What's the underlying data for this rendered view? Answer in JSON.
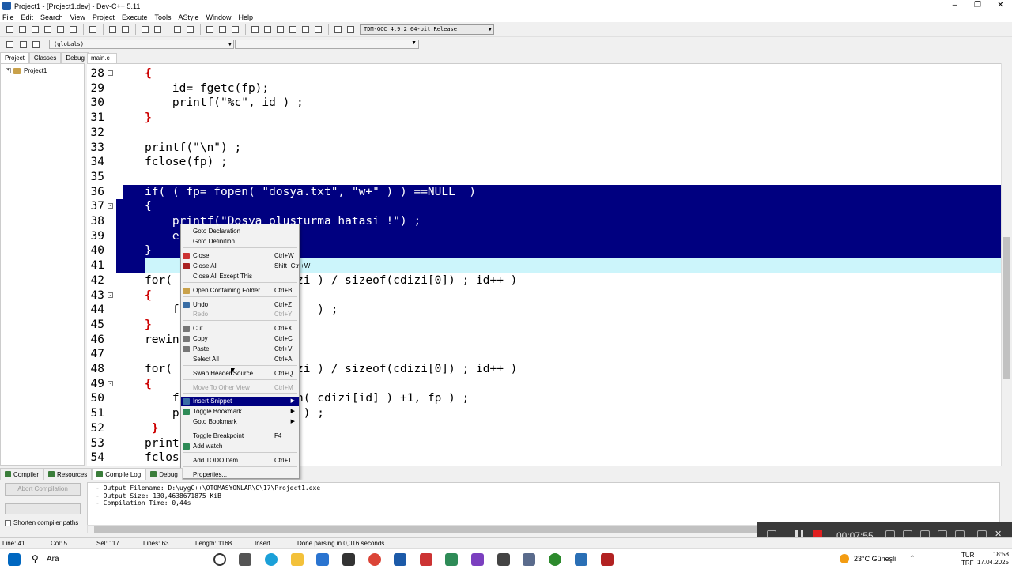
{
  "window": {
    "title": "Project1 - [Project1.dev] - Dev-C++ 5.11"
  },
  "menu": [
    "File",
    "Edit",
    "Search",
    "View",
    "Project",
    "Execute",
    "Tools",
    "AStyle",
    "Window",
    "Help"
  ],
  "compiler_select": "TDM-GCC 4.9.2 64-bit Release",
  "scope_select": "(globals)",
  "left_tabs": [
    "Project",
    "Classes",
    "Debug"
  ],
  "project_tree": {
    "root": "Project1"
  },
  "editor_tab": "main.c",
  "code_lines": [
    {
      "n": "28",
      "text": "{"
    },
    {
      "n": "29",
      "text": "    id= fgetc(fp);"
    },
    {
      "n": "30",
      "text": "    printf(\"%c\", id ) ;"
    },
    {
      "n": "31",
      "text": "}"
    },
    {
      "n": "32",
      "text": ""
    },
    {
      "n": "33",
      "text": "printf(\"\\n\") ;"
    },
    {
      "n": "34",
      "text": "fclose(fp) ;"
    },
    {
      "n": "35",
      "text": ""
    },
    {
      "n": "36",
      "text": "if( ( fp= fopen( \"dosya.txt\", \"w+\" ) ) ==NULL  )"
    },
    {
      "n": "37",
      "text": "{"
    },
    {
      "n": "38",
      "text": "    printf(\"Dosya olusturma hatasi !\") ;"
    },
    {
      "n": "39",
      "text": "    e"
    },
    {
      "n": "40",
      "text": "}"
    },
    {
      "n": "41",
      "text": ""
    },
    {
      "n": "42",
      "text": "for(                dizi ) / sizeof(cdizi[0]) ; id++ )"
    },
    {
      "n": "43",
      "text": "{"
    },
    {
      "n": "44",
      "text": "    f                    ) ;"
    },
    {
      "n": "45",
      "text": "}"
    },
    {
      "n": "46",
      "text": "rewin"
    },
    {
      "n": "47",
      "text": ""
    },
    {
      "n": "48",
      "text": "for(                dizi ) / sizeof(cdizi[0]) ; id++ )"
    },
    {
      "n": "49",
      "text": "{"
    },
    {
      "n": "50",
      "text": "    f                en( cdizi[id] ) +1, fp ) ;"
    },
    {
      "n": "51",
      "text": "    p                  ) ;"
    },
    {
      "n": "52",
      "text": " }"
    },
    {
      "n": "53",
      "text": "print"
    },
    {
      "n": "54",
      "text": "fclos"
    }
  ],
  "context_menu": {
    "items": [
      {
        "label": "Goto Declaration",
        "shortcut": "",
        "state": "normal"
      },
      {
        "label": "Goto Definition",
        "shortcut": "",
        "state": "normal"
      },
      {
        "label": "Close",
        "shortcut": "Ctrl+W",
        "state": "normal"
      },
      {
        "label": "Close All",
        "shortcut": "Shift+Ctrl+W",
        "state": "normal"
      },
      {
        "label": "Close All Except This",
        "shortcut": "",
        "state": "normal"
      },
      {
        "label": "Open Containing Folder...",
        "shortcut": "Ctrl+B",
        "state": "normal"
      },
      {
        "label": "Undo",
        "shortcut": "Ctrl+Z",
        "state": "normal"
      },
      {
        "label": "Redo",
        "shortcut": "Ctrl+Y",
        "state": "disabled"
      },
      {
        "label": "Cut",
        "shortcut": "Ctrl+X",
        "state": "normal"
      },
      {
        "label": "Copy",
        "shortcut": "Ctrl+C",
        "state": "normal"
      },
      {
        "label": "Paste",
        "shortcut": "Ctrl+V",
        "state": "normal"
      },
      {
        "label": "Select All",
        "shortcut": "Ctrl+A",
        "state": "normal"
      },
      {
        "label": "Swap Header/Source",
        "shortcut": "Ctrl+Q",
        "state": "normal"
      },
      {
        "label": "Move To Other View",
        "shortcut": "Ctrl+M",
        "state": "disabled"
      },
      {
        "label": "Insert Snippet",
        "shortcut": "",
        "state": "highlighted"
      },
      {
        "label": "Toggle Bookmark",
        "shortcut": "",
        "state": "normal"
      },
      {
        "label": "Goto Bookmark",
        "shortcut": "",
        "state": "normal"
      },
      {
        "label": "Toggle Breakpoint",
        "shortcut": "F4",
        "state": "normal"
      },
      {
        "label": "Add watch",
        "shortcut": "",
        "state": "normal"
      },
      {
        "label": "Add TODO Item...",
        "shortcut": "Ctrl+T",
        "state": "normal"
      },
      {
        "label": "Properties...",
        "shortcut": "",
        "state": "normal"
      }
    ]
  },
  "bottom_tabs": [
    "Compiler",
    "Resources",
    "Compile Log",
    "Debug"
  ],
  "abort_button": "Abort Compilation",
  "shorten_label": "Shorten compiler paths",
  "log_lines": [
    "- Output Filename: D:\\uygC++\\OTOMASYONLAR\\C\\17\\Project1.exe",
    "- Output Size: 130,4638671875 KiB",
    "- Compilation Time: 0,44s"
  ],
  "status": {
    "line": "Line:  41",
    "col": "Col:  5",
    "sel": "Sel:  117",
    "lines": "Lines:  63",
    "length": "Length:  1168",
    "mode": "Insert",
    "msg": "Done parsing in 0,016 seconds"
  },
  "recorder": {
    "time": "00:07:55"
  },
  "taskbar": {
    "search": "Ara",
    "weather": "23°C  Güneşli",
    "lang1": "TUR",
    "lang2": "TRF",
    "time": "18:58",
    "date": "17.04.2025"
  }
}
